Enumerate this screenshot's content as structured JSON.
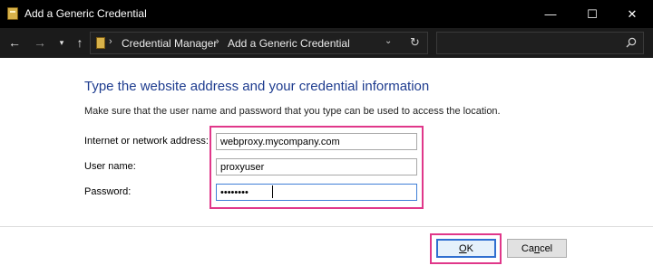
{
  "window": {
    "title": "Add a Generic Credential",
    "controls": {
      "minimize": "—",
      "maximize": "☐",
      "close": "✕"
    }
  },
  "nav": {
    "back": "←",
    "forward": "→",
    "recent": "▾",
    "up": "↑",
    "breadcrumbs": [
      "Credential Manager",
      "Add a Generic Credential"
    ],
    "separator": "›",
    "dropdown": "⌄",
    "refresh": "↻",
    "search_placeholder": ""
  },
  "form": {
    "heading": "Type the website address and your credential information",
    "description": "Make sure that the user name and password that you type can be used to access the location.",
    "fields": [
      {
        "label": "Internet or network address:",
        "value": "webproxy.mycompany.com"
      },
      {
        "label": "User name:",
        "value": "proxyuser"
      },
      {
        "label": "Password:",
        "value": "••••••••"
      }
    ]
  },
  "buttons": {
    "ok": {
      "pre": "",
      "accel": "O",
      "post": "K"
    },
    "cancel": {
      "pre": "Ca",
      "accel": "n",
      "post": "cel"
    }
  },
  "colors": {
    "heading": "#1e3c8f",
    "highlight": "#e0378a",
    "focus": "#2f6fd0"
  }
}
